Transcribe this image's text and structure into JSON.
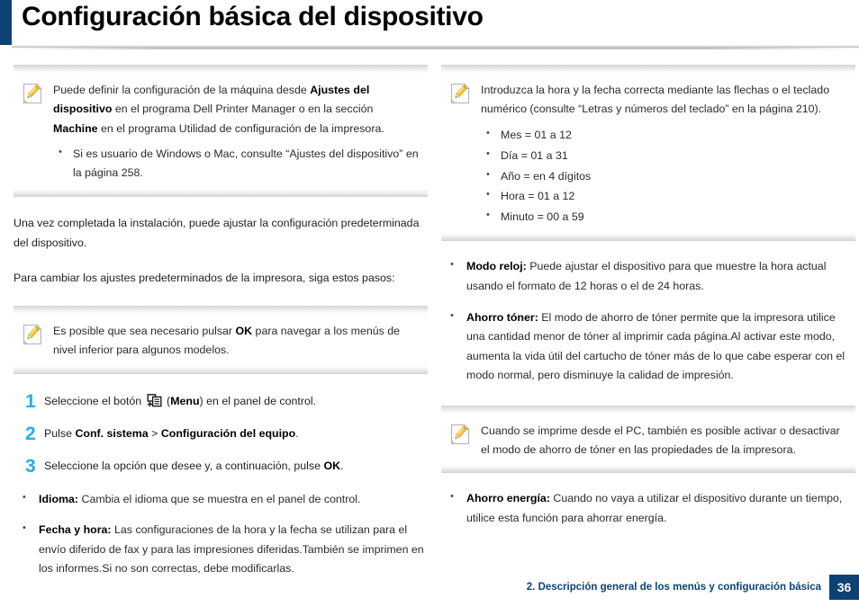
{
  "header": {
    "title": "Configuración básica del dispositivo",
    "accent_color": "#0d4273"
  },
  "left_column": {
    "note_1": {
      "icon": "note-pencil-icon",
      "text_part_1": "Puede definir la configuración de la máquina desde ",
      "bold_1": "Ajustes del dispositivo",
      "text_part_2": " en el programa Dell Printer Manager o en la sección ",
      "bold_2": "Machine",
      "text_part_3": " en el programa Utilidad de configuración de la impresora.",
      "bullets": [
        "Si es usuario de Windows o Mac, consulte “Ajustes del dispositivo” en la página 258."
      ]
    },
    "paragraph_1": "Una vez completada la instalación, puede ajustar la configuración predeterminada del dispositivo.",
    "paragraph_2": "Para cambiar los ajustes predeterminados de la impresora, siga estos pasos:",
    "note_2": {
      "icon": "note-pencil-icon",
      "text_part_1": "Es posible que sea necesario pulsar ",
      "bold_1": "OK",
      "text_part_2": " para navegar a los menús de nivel inferior para algunos modelos."
    },
    "steps": [
      {
        "number": "1",
        "text_part_1": "Seleccione el botón ",
        "icon": "menu-button-icon",
        "text_part_2": " (",
        "bold_1": "Menu",
        "text_part_3": ") en el panel de control."
      },
      {
        "number": "2",
        "text_part_1": "Pulse ",
        "bold_1": "Conf. sistema",
        "text_part_2": " > ",
        "bold_2": "Configuración del equipo",
        "text_part_3": "."
      },
      {
        "number": "3",
        "text_part_1": "Seleccione la opción que desee y, a continuación, pulse ",
        "bold_1": "OK",
        "text_part_2": "."
      }
    ],
    "step_bullets": [
      {
        "bold": "Idioma:",
        "text": " Cambia el idioma que se muestra en el panel de control."
      },
      {
        "bold": "Fecha y hora:",
        "text": " Las configuraciones de la hora y la fecha se utilizan para el envío diferido de fax y para las impresiones diferidas.También se imprimen en los informes.Si no son correctas, debe modificarlas."
      }
    ]
  },
  "right_column": {
    "note_1": {
      "icon": "note-pencil-icon",
      "text": "Introduzca la hora y la fecha correcta mediante las flechas o el teclado numérico (consulte “Letras y números del teclado” en la página 210).",
      "bullets": [
        "Mes = 01 a 12",
        "Día = 01 a 31",
        "Año = en 4 dígitos",
        "Hora = 01 a 12",
        "Minuto = 00 a 59"
      ]
    },
    "bullets_1": [
      {
        "bold": "Modo reloj:",
        "text": " Puede ajustar el dispositivo para que muestre la hora actual usando el formato de 12 horas o el de 24 horas."
      },
      {
        "bold": "Ahorro tóner:",
        "text": " El modo de ahorro de tóner permite que la impresora utilice una cantidad menor de tóner al imprimir cada página.Al activar este modo, aumenta la vida útil del cartucho de tóner más de lo que cabe esperar con el modo normal, pero disminuye la calidad de impresión."
      }
    ],
    "note_2": {
      "icon": "note-pencil-icon",
      "text": "Cuando se imprime desde el PC, también es posible activar o desactivar el modo de ahorro de tóner en las propiedades de la impresora."
    },
    "bullets_2": [
      {
        "bold": "Ahorro energía:",
        "text": " Cuando no vaya a utilizar el dispositivo durante un tiempo, utilice esta función para ahorrar energía."
      }
    ]
  },
  "footer": {
    "chapter_text": "2. Descripción general de los menús y configuración básica",
    "page_number": "36",
    "badge_color": "#0d4273"
  }
}
